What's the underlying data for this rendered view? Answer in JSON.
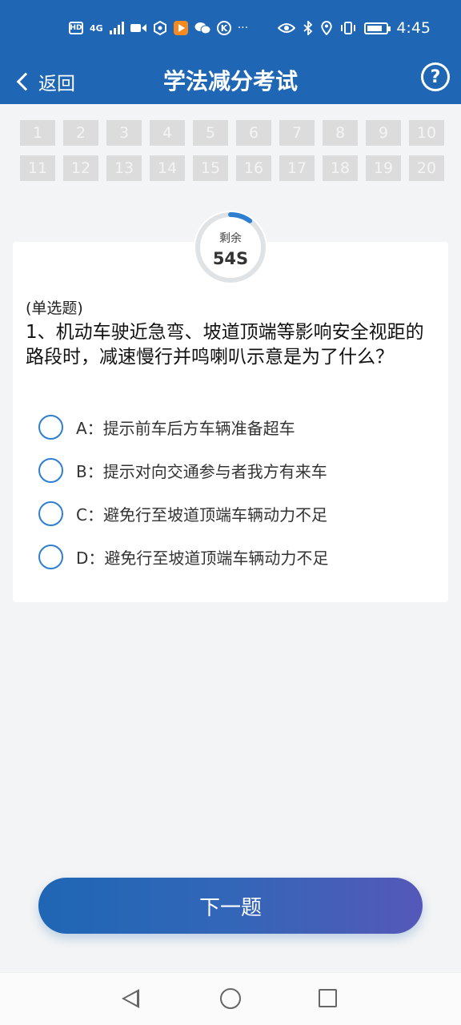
{
  "status_bar": {
    "left_icons": [
      "HD",
      "4G",
      "signal-icon",
      "video-icon",
      "hexagon-icon",
      "play-icon",
      "wechat-icon",
      "k-icon",
      "more-icon"
    ],
    "hd_label": "HD",
    "net_label": "4G",
    "more_label": "···",
    "time": "4:45"
  },
  "header": {
    "back_label": "返回",
    "title": "学法减分考试",
    "help_label": "?"
  },
  "question_numbers": [
    "1",
    "2",
    "3",
    "4",
    "5",
    "6",
    "7",
    "8",
    "9",
    "10",
    "11",
    "12",
    "13",
    "14",
    "15",
    "16",
    "17",
    "18",
    "19",
    "20"
  ],
  "timer": {
    "label": "剩余",
    "value": "54S",
    "progress": 0.1
  },
  "question": {
    "type": "(单选题)",
    "text": "1、机动车驶近急弯、坡道顶端等影响安全视距的路段时，减速慢行并鸣喇叭示意是为了什么？"
  },
  "options": [
    {
      "letter": "A：",
      "text": "提示前车后方车辆准备超车"
    },
    {
      "letter": "B：",
      "text": "提示对向交通参与者我方有来车"
    },
    {
      "letter": "C：",
      "text": "避免行至坡道顶端车辆动力不足"
    },
    {
      "letter": "D：",
      "text": "避免行至坡道顶端车辆动力不足"
    }
  ],
  "next_button": "下一题",
  "colors": {
    "primary": "#1f66b5",
    "accent": "#2f7fd1",
    "cell_bg": "#dcdcdc"
  }
}
